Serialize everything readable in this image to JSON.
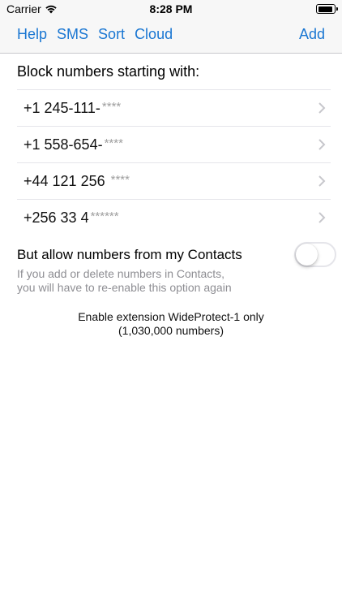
{
  "status_bar": {
    "carrier": "Carrier",
    "time": "8:28 PM"
  },
  "nav": {
    "help": "Help",
    "sms": "SMS",
    "sort": "Sort",
    "cloud": "Cloud",
    "add": "Add",
    "accent_color": "#1976d2"
  },
  "block_section": {
    "header": "Block numbers starting with:",
    "rows": [
      {
        "prefix": "+1 245-111-",
        "mask": "****"
      },
      {
        "prefix": "+1 558-654-",
        "mask": "****"
      },
      {
        "prefix": "+44 121 256 ",
        "mask": "****"
      },
      {
        "prefix": "+256 33 4",
        "mask": "******"
      }
    ]
  },
  "contacts_option": {
    "label": "But allow numbers from my Contacts",
    "enabled": false,
    "hint_line1": "If you add or delete numbers in Contacts,",
    "hint_line2": "you will have to re-enable this option again"
  },
  "footer": {
    "line1": "Enable extension WideProtect-1 only",
    "line2": "(1,030,000 numbers)"
  }
}
